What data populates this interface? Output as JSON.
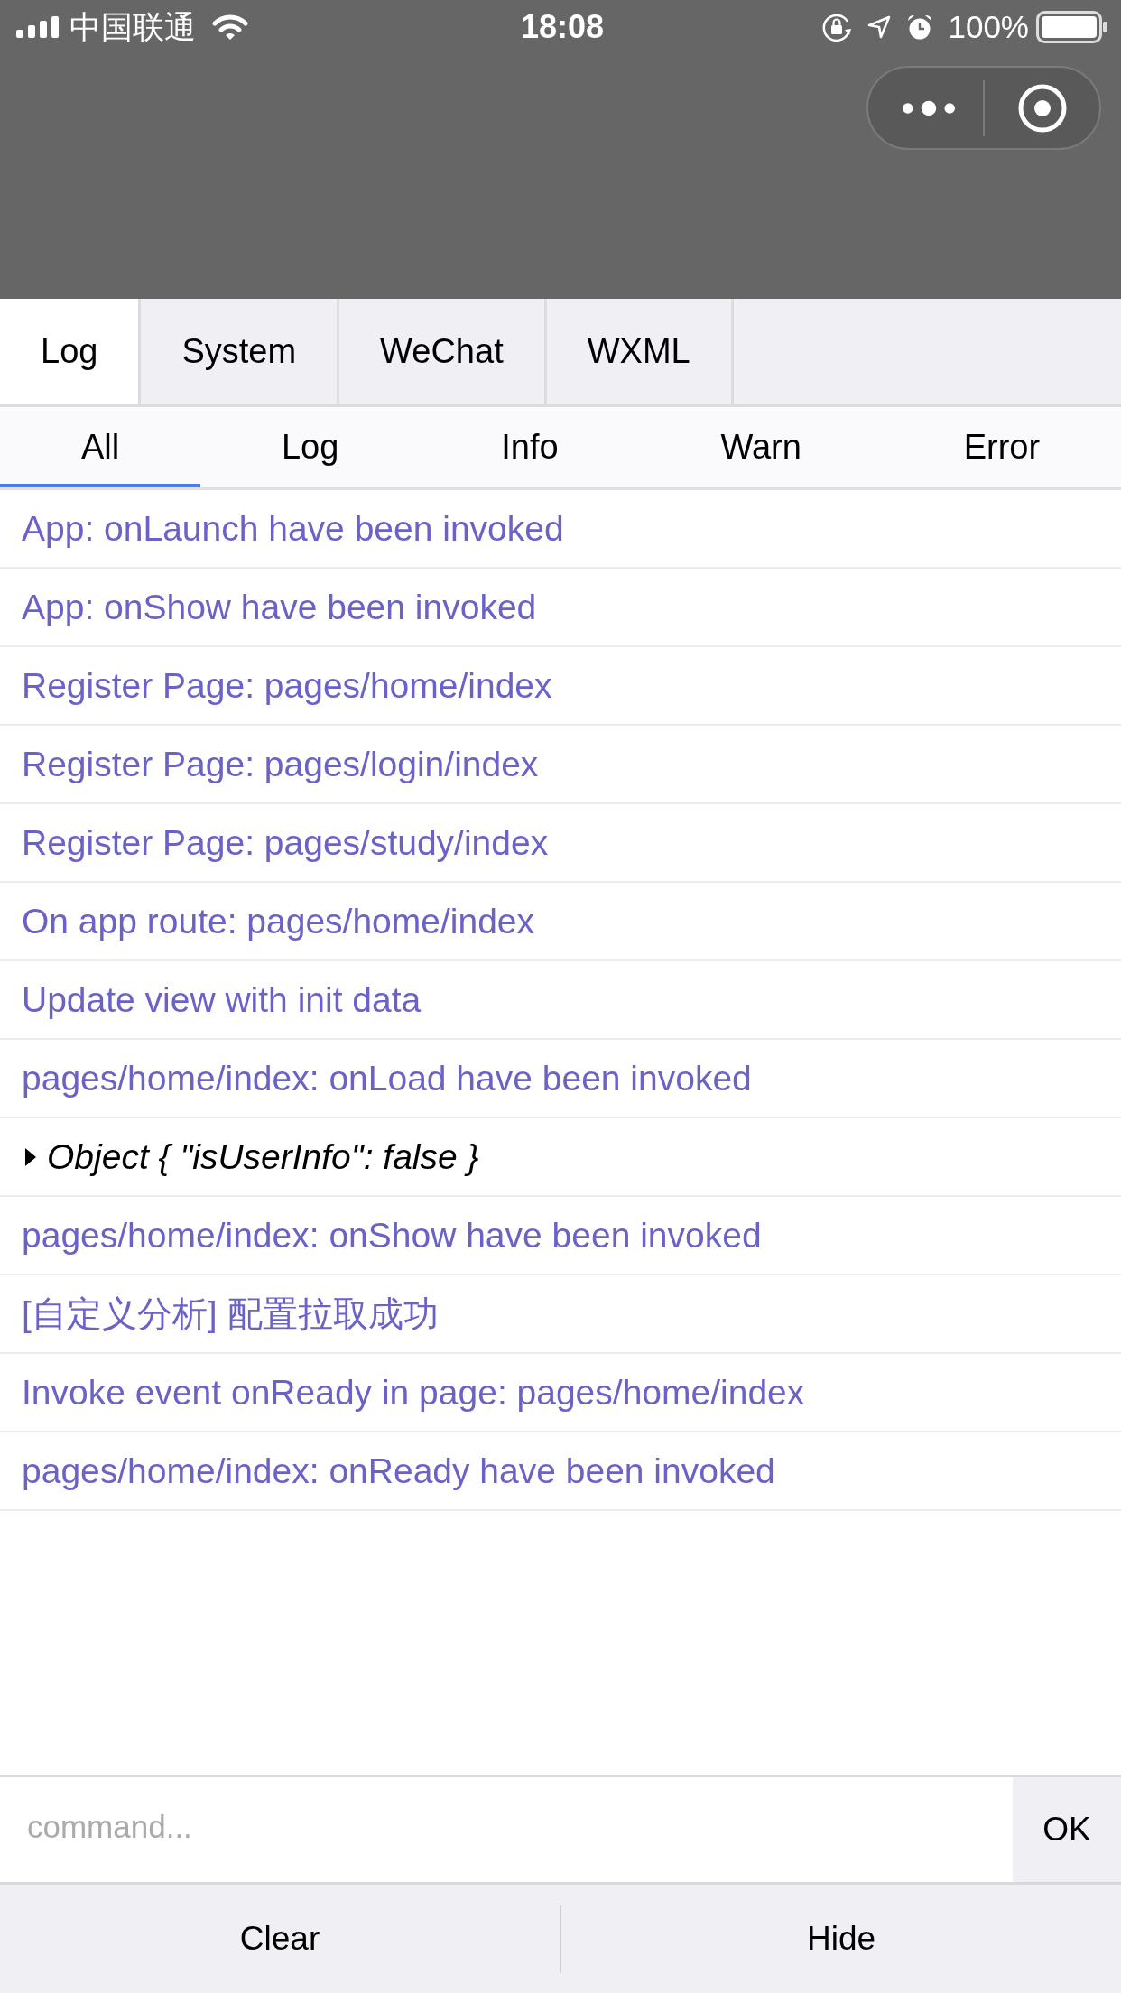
{
  "status_bar": {
    "carrier": "中国联通",
    "time": "18:08",
    "battery": "100%"
  },
  "tabs": [
    {
      "label": "Log",
      "selected": true
    },
    {
      "label": "System",
      "selected": false
    },
    {
      "label": "WeChat",
      "selected": false
    },
    {
      "label": "WXML",
      "selected": false
    }
  ],
  "filters": [
    {
      "label": "All",
      "selected": true
    },
    {
      "label": "Log",
      "selected": false
    },
    {
      "label": "Info",
      "selected": false
    },
    {
      "label": "Warn",
      "selected": false
    },
    {
      "label": "Error",
      "selected": false
    }
  ],
  "logs": [
    {
      "kind": "message",
      "text": "App: onLaunch have been invoked"
    },
    {
      "kind": "message",
      "text": "App: onShow have been invoked"
    },
    {
      "kind": "message",
      "text": "Register Page: pages/home/index"
    },
    {
      "kind": "message",
      "text": "Register Page: pages/login/index"
    },
    {
      "kind": "message",
      "text": "Register Page: pages/study/index"
    },
    {
      "kind": "message",
      "text": "On app route: pages/home/index"
    },
    {
      "kind": "message",
      "text": "Update view with init data"
    },
    {
      "kind": "message",
      "text": "pages/home/index: onLoad have been invoked"
    },
    {
      "kind": "object",
      "text": "Object { \"isUserInfo\": false }",
      "expanded": false
    },
    {
      "kind": "message",
      "text": "pages/home/index: onShow have been invoked"
    },
    {
      "kind": "message",
      "text": "[自定义分析] 配置拉取成功"
    },
    {
      "kind": "message",
      "text": "Invoke event onReady in page: pages/home/index"
    },
    {
      "kind": "message",
      "text": "pages/home/index: onReady have been invoked"
    }
  ],
  "command": {
    "placeholder": "command...",
    "button": "OK"
  },
  "footer": {
    "buttons": [
      "Clear",
      "Hide"
    ]
  }
}
